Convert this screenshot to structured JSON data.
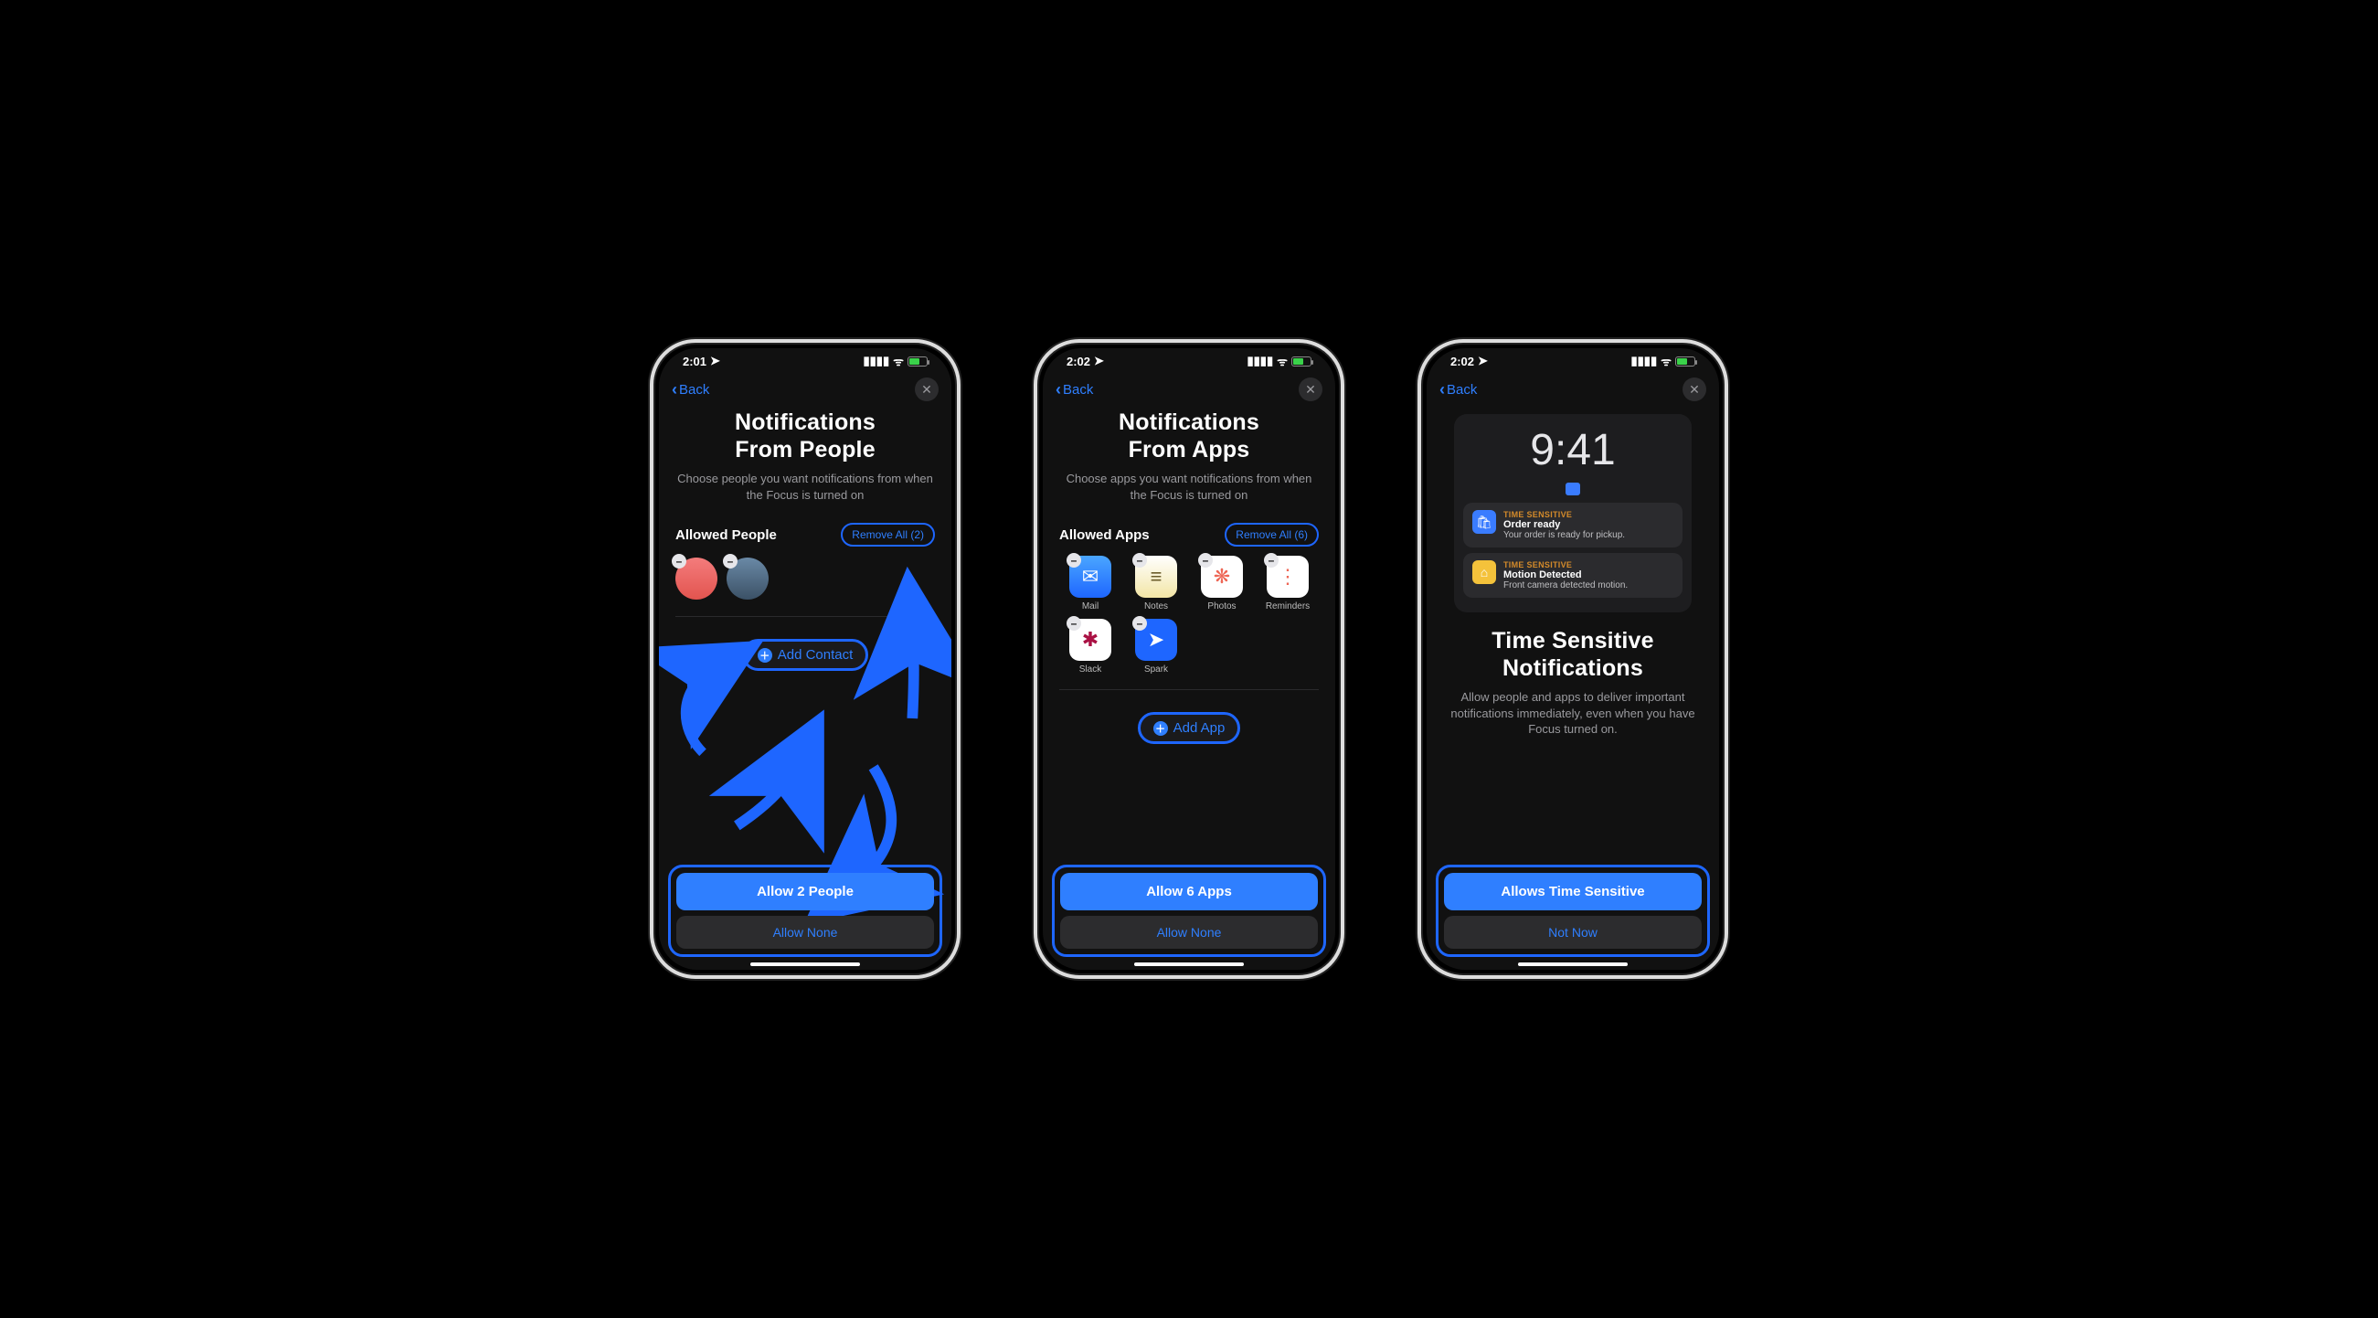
{
  "phones": [
    {
      "status_time": "2:01",
      "back_label": "Back",
      "title_line1": "Notifications",
      "title_line2": "From People",
      "subtitle": "Choose people you want notifications from when the Focus is turned on",
      "section_title": "Allowed People",
      "remove_all": "Remove All (2)",
      "add_label": "Add Contact",
      "primary": "Allow 2 People",
      "secondary": "Allow None",
      "people": [
        {
          "name": "contact-1",
          "bg": "linear-gradient(#f47c7c,#e2544f)"
        },
        {
          "name": "contact-2",
          "bg": "linear-gradient(#6a89a6,#3b5166)"
        }
      ]
    },
    {
      "status_time": "2:02",
      "back_label": "Back",
      "title_line1": "Notifications",
      "title_line2": "From Apps",
      "subtitle": "Choose apps you want notifications from when the Focus is turned on",
      "section_title": "Allowed Apps",
      "remove_all": "Remove All (6)",
      "add_label": "Add App",
      "primary": "Allow 6 Apps",
      "secondary": "Allow None",
      "apps": [
        {
          "label": "Mail",
          "icon": "✉︎",
          "cls": "i-mail",
          "fg": "#fff"
        },
        {
          "label": "Notes",
          "icon": "≡",
          "cls": "i-notes",
          "fg": "#6b5c2a"
        },
        {
          "label": "Photos",
          "icon": "❋",
          "cls": "i-photos",
          "fg": "#e65"
        },
        {
          "label": "Reminders",
          "icon": "⋮",
          "cls": "i-rem",
          "fg": "#e65"
        },
        {
          "label": "Slack",
          "icon": "✱",
          "cls": "i-slack",
          "fg": "#a14"
        },
        {
          "label": "Spark",
          "icon": "➤",
          "cls": "i-spark",
          "fg": "#fff"
        }
      ]
    },
    {
      "status_time": "2:02",
      "back_label": "Back",
      "preview_time": "9:41",
      "notifs": [
        {
          "tag": "TIME SENSITIVE",
          "title": "Order ready",
          "body": "Your order is ready for pickup.",
          "icon": "🛍",
          "cls": "i-bag"
        },
        {
          "tag": "TIME SENSITIVE",
          "title": "Motion Detected",
          "body": "Front camera detected motion.",
          "icon": "⌂",
          "cls": "i-home"
        }
      ],
      "title_line1": "Time Sensitive",
      "title_line2": "Notifications",
      "subtitle": "Allow people and apps to deliver important notifications immediately, even when you have Focus turned on.",
      "primary": "Allows Time Sensitive",
      "secondary": "Not Now"
    }
  ]
}
